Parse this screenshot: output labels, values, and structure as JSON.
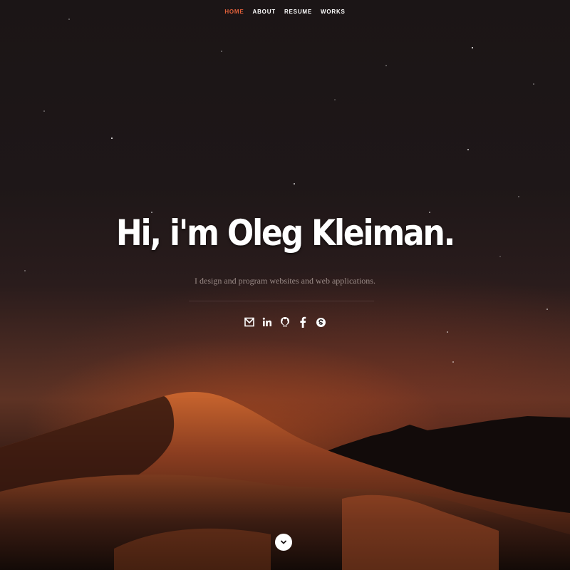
{
  "nav": {
    "items": [
      {
        "label": "HOME",
        "active": true
      },
      {
        "label": "ABOUT",
        "active": false
      },
      {
        "label": "RESUME",
        "active": false
      },
      {
        "label": "WORKS",
        "active": false
      }
    ],
    "active_color": "#e0603a"
  },
  "banner": {
    "headline": "Hi, i'm Oleg Kleiman.",
    "tagline": "I design and program websites and web applications."
  },
  "social": {
    "icons": [
      "envelope-icon",
      "linkedin-icon",
      "github-icon",
      "facebook-icon",
      "skype-icon"
    ]
  },
  "scroll_down": {
    "icon": "chevron-down-icon"
  },
  "colors": {
    "accent": "#e0603a",
    "text": "#ffffff",
    "tagline": "#9a8a86"
  }
}
